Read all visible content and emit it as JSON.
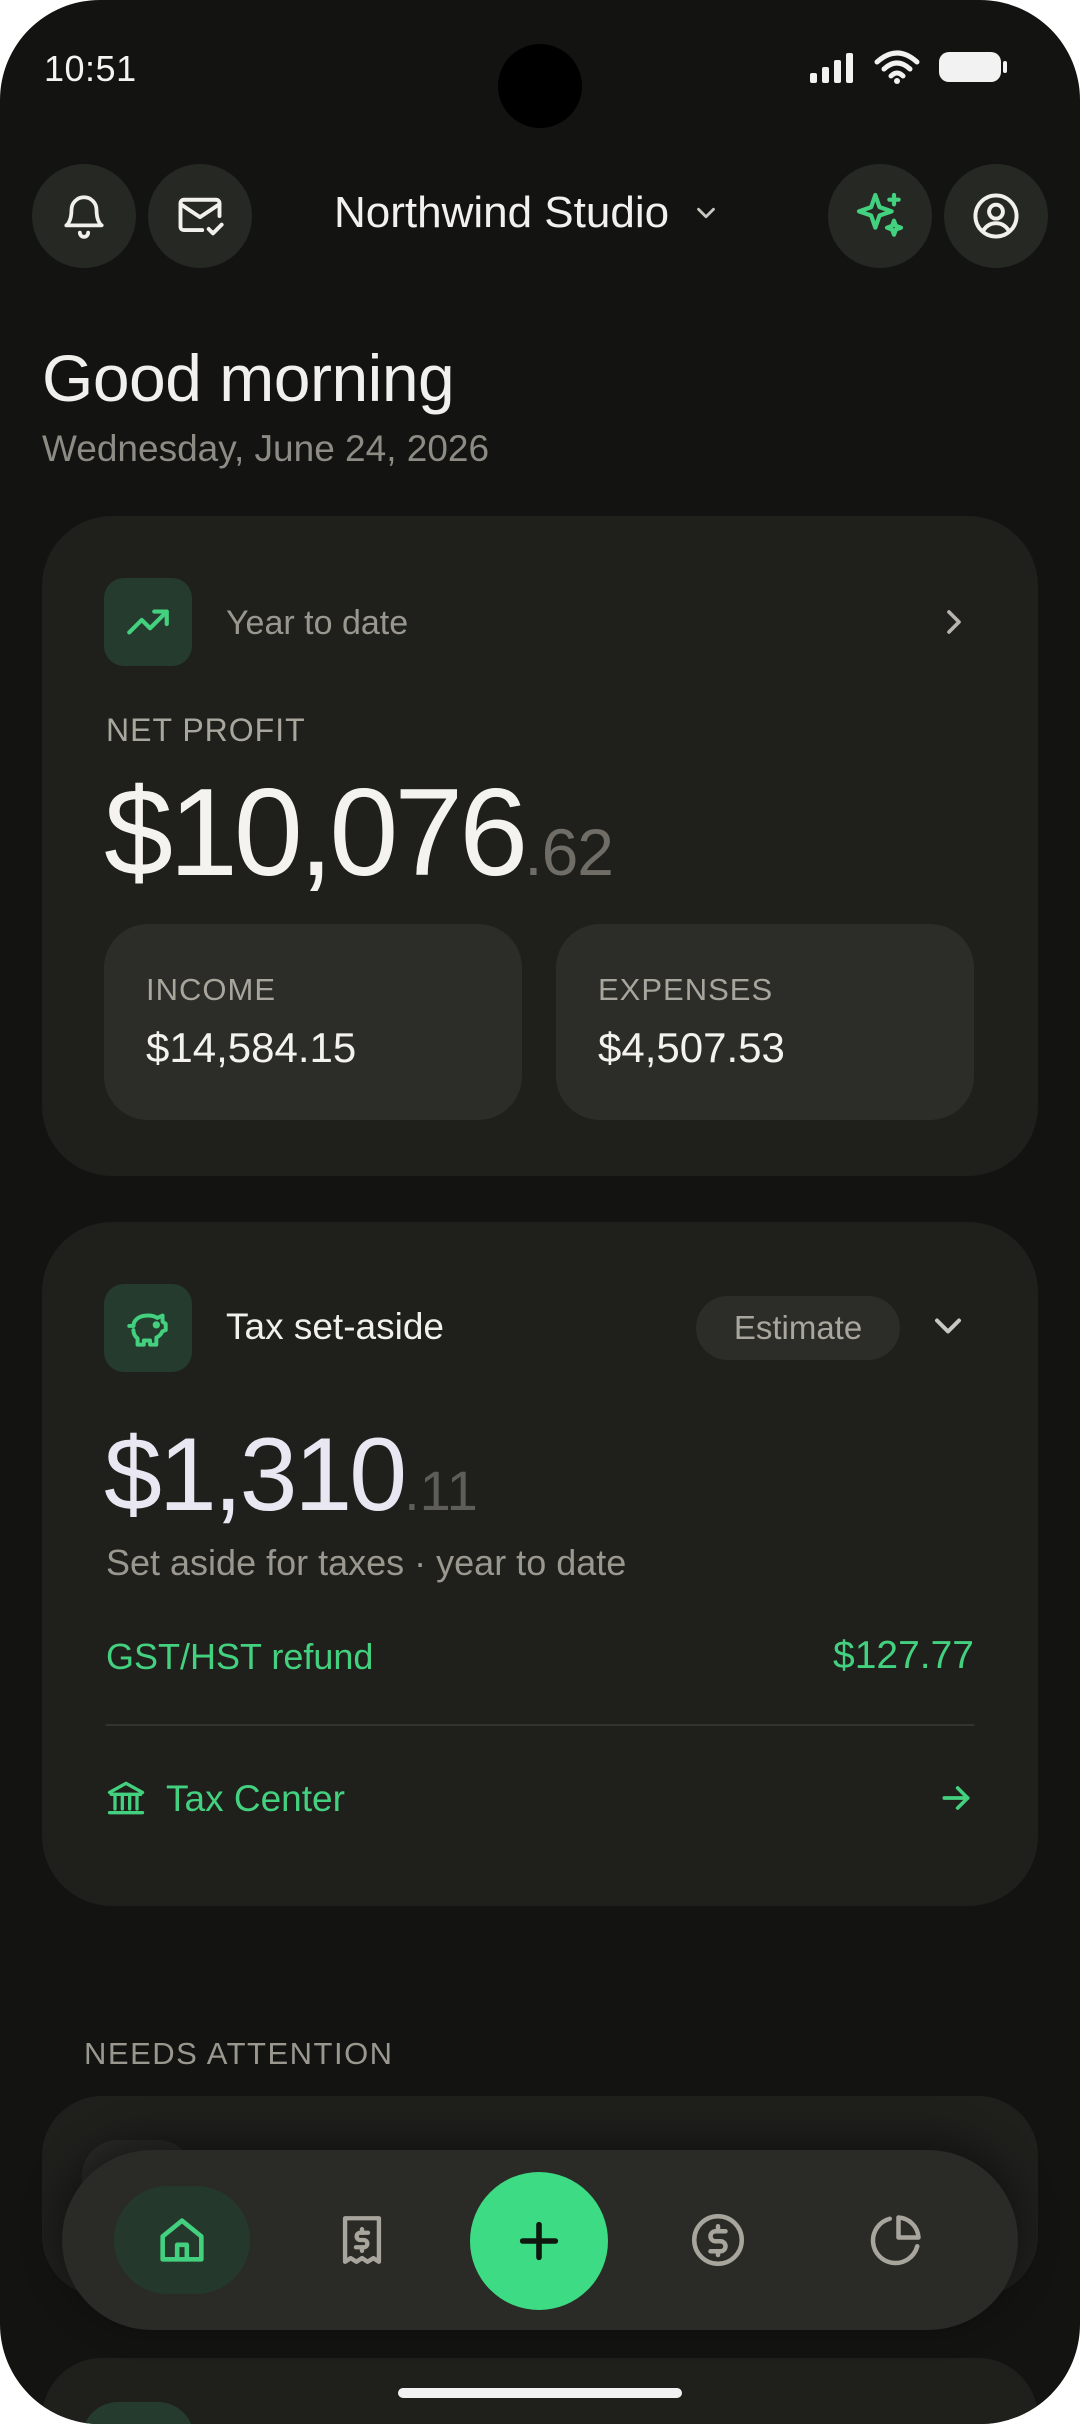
{
  "status_bar": {
    "time": "10:51"
  },
  "header": {
    "workspace_name": "Northwind Studio"
  },
  "greeting": {
    "title": "Good morning",
    "date": "Wednesday, June 24, 2026"
  },
  "profit_card": {
    "period_label": "Year to date",
    "net_profit_label": "NET PROFIT",
    "net_profit_dollars": "$10,076",
    "net_profit_cents": ".62",
    "income_label": "INCOME",
    "income_value": "$14,584.15",
    "expenses_label": "EXPENSES",
    "expenses_value": "$4,507.53"
  },
  "tax_card": {
    "title": "Tax set-aside",
    "badge": "Estimate",
    "amount_dollars": "$1,310",
    "amount_cents": ".11",
    "subtitle": "Set aside for taxes · year to date",
    "refund_label": "GST/HST refund",
    "refund_value": "$127.77",
    "link_label": "Tax Center"
  },
  "sections": {
    "needs_attention": "NEEDS ATTENTION"
  },
  "colors": {
    "accent": "#3ddc84",
    "background": "#131411",
    "card": "#1f201c"
  },
  "icons": {
    "header": [
      "bell-icon",
      "mail-check-icon",
      "sparkles-icon",
      "profile-icon"
    ],
    "nav": [
      "home-icon",
      "receipt-icon",
      "plus-icon",
      "dollar-icon",
      "pie-chart-icon"
    ]
  }
}
